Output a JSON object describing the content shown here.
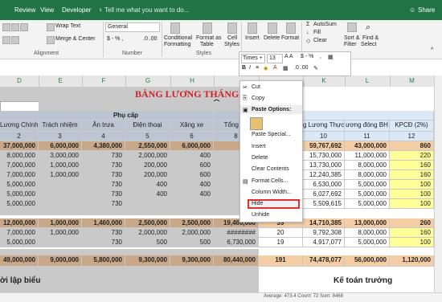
{
  "tabs": {
    "review": "Review",
    "view": "View",
    "developer": "Developer",
    "tellme": "Tell me what you want to do...",
    "share": "Share"
  },
  "ribbon": {
    "wrap_text": "Wrap Text",
    "merge_center": "Merge & Center",
    "format": "General",
    "conditional": "Conditional",
    "formatting": "Formatting",
    "format_as": "Format as",
    "table": "Table",
    "cell": "Cell",
    "styles": "Styles",
    "insert": "Insert",
    "delete": "Delete",
    "format_btn": "Format",
    "autosum": "AutoSum",
    "fill": "Fill",
    "clear": "Clear",
    "sort": "Sort &",
    "filter": "Filter",
    "find": "Find &",
    "select": "Select",
    "g_alignment": "Alignment",
    "g_number": "Number",
    "g_styles": "Styles",
    "font_name": "Times +",
    "font_size": "13"
  },
  "colors": {
    "ribbon_green": "#217346",
    "header_blue": "#dbe9f7",
    "orange": "#f4cda4",
    "yellow": "#ffff99",
    "hide_highlight": "#e03030",
    "gray_sel": "#c0c0c0"
  },
  "columns": [
    "D",
    "E",
    "F",
    "G",
    "H",
    "",
    "",
    "K",
    "L",
    "M"
  ],
  "title": "BẢNG LƯƠNG THÁNG",
  "title2": "Phụ cấp",
  "headers": {
    "d": "Lương Chính",
    "e": "Trách nhiệm",
    "f": "Ăn trưa",
    "g": "Điện thoại",
    "h": "Xăng xe",
    "i": "Tổng Th",
    "j": "g Lương Thực",
    "k": "ương đóng BH",
    "l": "KPCĐ (2%)"
  },
  "nums": [
    "2",
    "3",
    "4",
    "5",
    "6",
    "8",
    "10",
    "11",
    "12"
  ],
  "rows": [
    {
      "d": "37,000,000",
      "e": "6,000,000",
      "f": "4,380,000",
      "g": "2,550,000",
      "h": "6,000,000",
      "j": "59,767,692",
      "k": "43,000,000",
      "l": "860"
    },
    {
      "d": "8,000,000",
      "e": "3,000,000",
      "f": "730",
      "g": "2,000,000",
      "h": "400",
      "j": "15,730,000",
      "k": "11,000,000",
      "l": "220"
    },
    {
      "d": "7,000,000",
      "e": "1,000,000",
      "f": "730",
      "g": "200,000",
      "h": "600",
      "j": "13,730,000",
      "k": "8,000,000",
      "l": "160"
    },
    {
      "d": "7,000,000",
      "e": "1,000,000",
      "f": "730",
      "g": "200,000",
      "h": "600",
      "j": "12,240,385",
      "k": "8,000,000",
      "l": "160"
    },
    {
      "d": "5,000,000",
      "e": "",
      "f": "730",
      "g": "400",
      "h": "400",
      "j": "6,530,000",
      "k": "5,000,000",
      "l": "100"
    },
    {
      "d": "5,000,000",
      "e": "",
      "f": "730",
      "g": "400",
      "h": "400",
      "j": "6,027,692",
      "k": "5,000,000",
      "l": "100"
    },
    {
      "d": "5,000,000",
      "e": "",
      "f": "730",
      "g": "",
      "h": "",
      "j": "5,509,615",
      "k": "5,000,000",
      "l": "100"
    }
  ],
  "rows2": [
    {
      "d": "12,000,000",
      "e": "1,000,000",
      "f": "1,460,000",
      "g": "2,500,000",
      "h": "2,500,000",
      "i": "19,460,000",
      "j2": "39",
      "j": "14,710,385",
      "k": "13,000,000",
      "l": "260"
    },
    {
      "d": "7,000,000",
      "e": "1,000,000",
      "f": "730",
      "g": "2,000,000",
      "h": "2,000,000",
      "i": "########",
      "j2": "20",
      "j": "9,792,308",
      "k": "8,000,000",
      "l": "160"
    },
    {
      "d": "5,000,000",
      "e": "",
      "f": "730",
      "g": "500",
      "h": "500",
      "i": "6,730,000",
      "j2": "19",
      "j": "4,917,077",
      "k": "5,000,000",
      "l": "100"
    }
  ],
  "total": {
    "d": "49,000,000",
    "e": "9,000,000",
    "f": "5,800,000",
    "g": "9,300,000",
    "h": "9,300,000",
    "i": "80,440,000",
    "j2": "191",
    "j": "74,478,077",
    "k": "56,000,000",
    "l": "1,120,000"
  },
  "footer_left": "ời lập biểu",
  "footer_right": "Kế toán trưởng",
  "menu": [
    "Cut",
    "Copy",
    "Paste Options:",
    "Paste Special...",
    "Insert",
    "Delete",
    "Clear Contents",
    "Format Cells...",
    "Column Width...",
    "Hide",
    "Unhide"
  ],
  "status": "Average: 473.4   Count: 72   Sum: 8468"
}
